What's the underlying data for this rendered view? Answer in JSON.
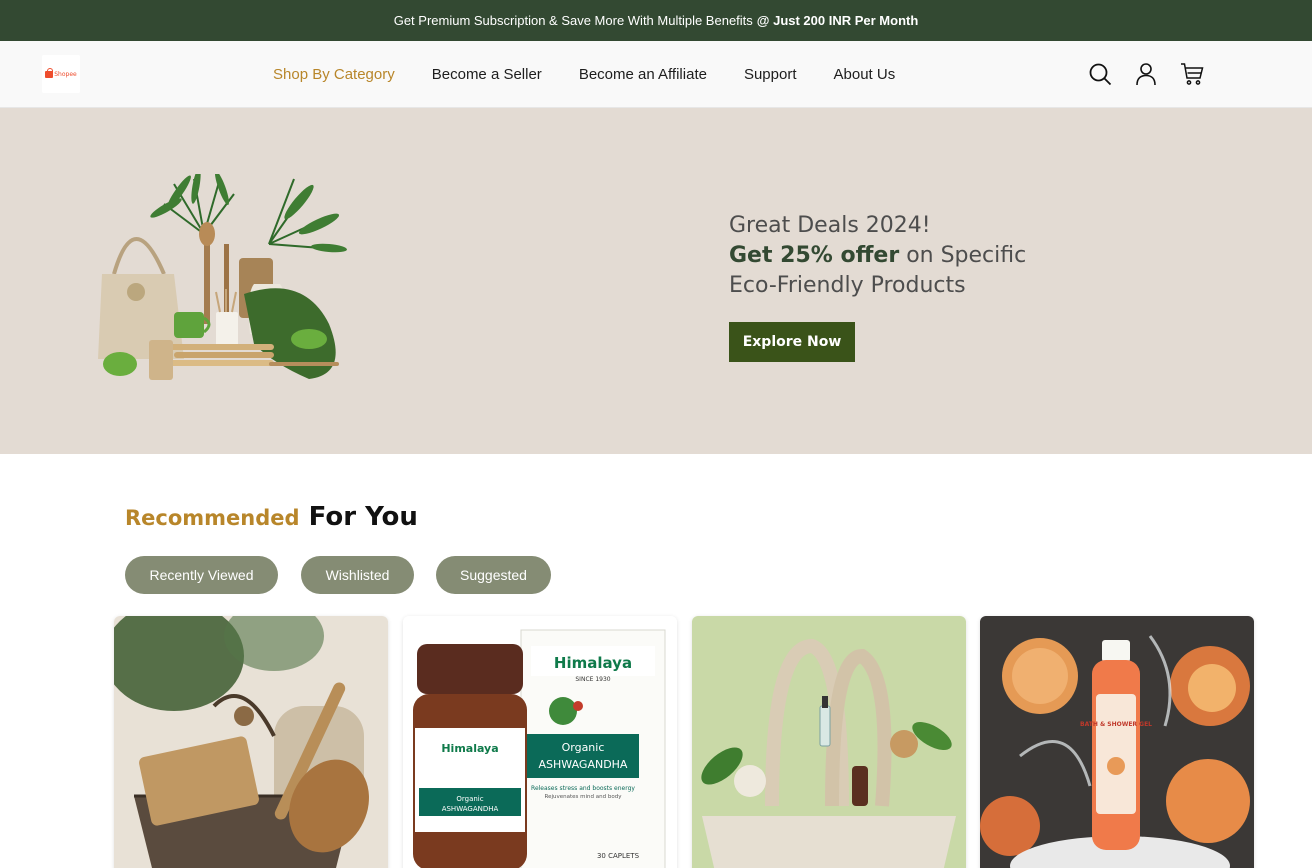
{
  "promo": {
    "text": "Get Premium Subscription & Save More With Multiple Benefits",
    "highlight": "@ Just 200 INR Per Month"
  },
  "logo": {
    "text": "Shopee",
    "color": "#ee4d2d"
  },
  "nav": {
    "links": [
      {
        "label": "Shop By Category",
        "active": true
      },
      {
        "label": "Become a Seller",
        "active": false
      },
      {
        "label": "Become an Affiliate",
        "active": false
      },
      {
        "label": "Support",
        "active": false
      },
      {
        "label": "About Us",
        "active": false
      }
    ],
    "icons": [
      "search-icon",
      "user-icon",
      "cart-icon"
    ]
  },
  "hero": {
    "line1": "Great Deals 2024!",
    "offer_bold": "Get 25% offer",
    "offer_rest": "on Specific",
    "line3": "Eco-Friendly Products",
    "cta": "Explore Now"
  },
  "recommended": {
    "title_accent": "Recommended",
    "title_rest": "For You",
    "filters": [
      "Recently Viewed",
      "Wishlisted",
      "Suggested"
    ]
  },
  "products": [
    {
      "image": "soap-basket-bamboo-brush"
    },
    {
      "image": "himalaya-ashwagandha",
      "brand": "Himalaya",
      "since": "SINCE 1930",
      "name_top": "Organic",
      "name": "ASHWAGANDHA",
      "tagline": "Releases stress and boosts energy",
      "tagline2": "Rejuvenates mind and body",
      "count": "30 CAPLETS"
    },
    {
      "image": "canvas-tote-bag"
    },
    {
      "image": "bath-shower-gel-peach",
      "label": "BATH & SHOWER GEL"
    }
  ],
  "colors": {
    "promo_bg": "#334932",
    "accent": "#b8862a",
    "hero_bg": "#e3dbd3",
    "cta_bg": "#3a5319",
    "pill_bg": "#858c74"
  }
}
